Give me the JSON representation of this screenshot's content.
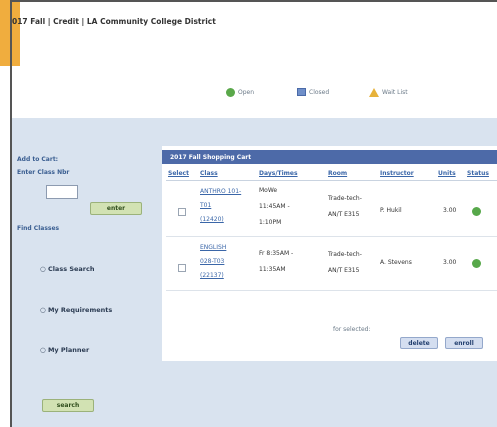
{
  "page": {
    "title": "017 Fall | Credit | LA Community College District"
  },
  "legend": {
    "open": "Open",
    "closed": "Closed",
    "wait_list": "Wait List"
  },
  "sidebar": {
    "add_to_cart": "Add to Cart:",
    "enter_class_nbr": "Enter Class Nbr",
    "class_nbr_value": "",
    "enter_button": "enter",
    "find_classes": "Find Classes",
    "options": [
      {
        "label": "Class Search"
      },
      {
        "label": "My Requirements"
      },
      {
        "label": "My Planner"
      }
    ],
    "search_button": "search"
  },
  "cart": {
    "title": "2017 Fall Shopping Cart",
    "columns": [
      "Select",
      "Class",
      "Days/Times",
      "Room",
      "Instructor",
      "Units",
      "Status"
    ],
    "rows": [
      {
        "class_line1": "ANTHRO 101-",
        "class_line2": "T01",
        "class_line3": "(12420)",
        "days_line1": "MoWe",
        "days_line2": "11:45AM -",
        "days_line3": "1:10PM",
        "room_line1": "Trade-tech-",
        "room_line2": "AN/T E315",
        "instructor": "P. Hukil",
        "units": "3.00",
        "status": "open"
      },
      {
        "class_line1": "ENGLISH",
        "class_line2": "028-T03",
        "class_line3": "(22137)",
        "days_line1": "Fr 8:35AM -",
        "days_line2": "11:35AM",
        "days_line3": "",
        "room_line1": "Trade-tech-",
        "room_line2": "AN/T E315",
        "instructor": "A. Stevens",
        "units": "3.00",
        "status": "open"
      }
    ],
    "for_selected": "for selected:",
    "delete_button": "delete",
    "enroll_button": "enroll"
  },
  "colors": {
    "accent_tab": "#f0ad3e",
    "header_blue": "#4d6aa8",
    "panel_bg": "#d9e3ef",
    "open_green": "#57a84a"
  }
}
